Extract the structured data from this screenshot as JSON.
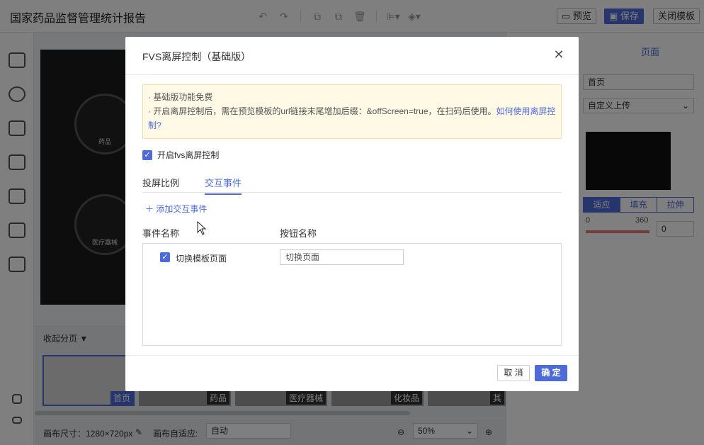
{
  "app": {
    "title": "国家药品监督管理统计报告",
    "toolbar": {
      "preview": "预览",
      "save": "保存",
      "close_template": "关闭模板"
    }
  },
  "canvas": {
    "preview_items": [
      "药品",
      "医疗器械"
    ],
    "pages_toggle": "收起分页",
    "pages": [
      {
        "label": "首页",
        "active": true
      },
      {
        "label": "药品",
        "active": false
      },
      {
        "label": "医疗器械",
        "active": false
      },
      {
        "label": "化妆品",
        "active": false
      },
      {
        "label": "其",
        "active": false
      }
    ],
    "status": {
      "size_label": "画布尺寸：1280×720px",
      "adapt_label": "画布自适应:",
      "adapt_value": "自动",
      "zoom_value": "50%"
    }
  },
  "right_panel": {
    "title": "页面",
    "page_name": "首页",
    "bg_mode": "自定义上传",
    "fit_options": [
      "适应",
      "填充",
      "拉伸"
    ],
    "rotate_min": "0",
    "rotate_max": "360",
    "rotate_value": "0"
  },
  "dialog": {
    "title": "FVS离屏控制（基础版）",
    "notice": {
      "line1": "· 基础版功能免费",
      "line2": "· 开启离屏控制后，需在预览模板的url链接末尾增加后缀：&offScreen=true，在扫码后使用。",
      "link": "如何使用离屏控制?"
    },
    "enable_label": "开启fvs离屏控制",
    "tabs": [
      "投屏比例",
      "交互事件"
    ],
    "active_tab": 1,
    "add_event": "添加交互事件",
    "columns": {
      "event_name": "事件名称",
      "button_name": "按钮名称"
    },
    "events": [
      {
        "checked": true,
        "name": "切换模板页面",
        "button": "切换页面"
      }
    ],
    "cancel": "取 消",
    "ok": "确 定"
  }
}
